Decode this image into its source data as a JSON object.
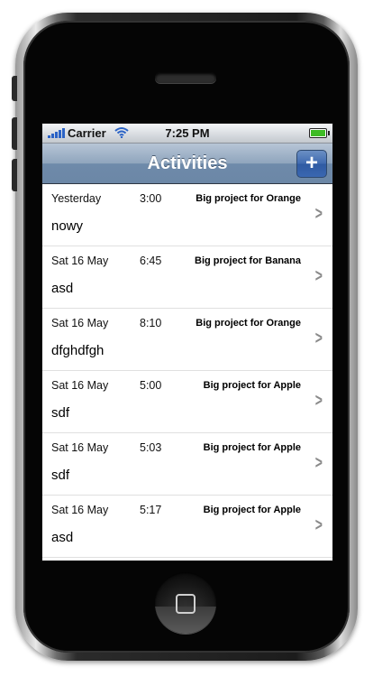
{
  "status_bar": {
    "carrier": "Carrier",
    "time": "7:25 PM",
    "signal_icon": "signal-bars-icon",
    "wifi_icon": "wifi-icon",
    "battery_icon": "battery-icon",
    "battery_level": 1.0
  },
  "nav": {
    "title": "Activities",
    "add_label": "+"
  },
  "rows": [
    {
      "date": "Yesterday",
      "duration": "3:00",
      "project": "Big project for Orange",
      "name": "nowy"
    },
    {
      "date": "Sat 16 May",
      "duration": "6:45",
      "project": "Big project for Banana",
      "name": "asd"
    },
    {
      "date": "Sat 16 May",
      "duration": "8:10",
      "project": "Big project for Orange",
      "name": "dfghdfgh"
    },
    {
      "date": "Sat 16 May",
      "duration": "5:00",
      "project": "Big project for Apple",
      "name": "sdf"
    },
    {
      "date": "Sat 16 May",
      "duration": "5:03",
      "project": "Big project for Apple",
      "name": "sdf"
    },
    {
      "date": "Sat 16 May",
      "duration": "5:17",
      "project": "Big project for Apple",
      "name": "asd"
    }
  ],
  "colors": {
    "nav_bar": "#6d88a7",
    "add_button": "#3a67b1",
    "signal": "#2b63c6",
    "battery": "#3dbb25"
  }
}
